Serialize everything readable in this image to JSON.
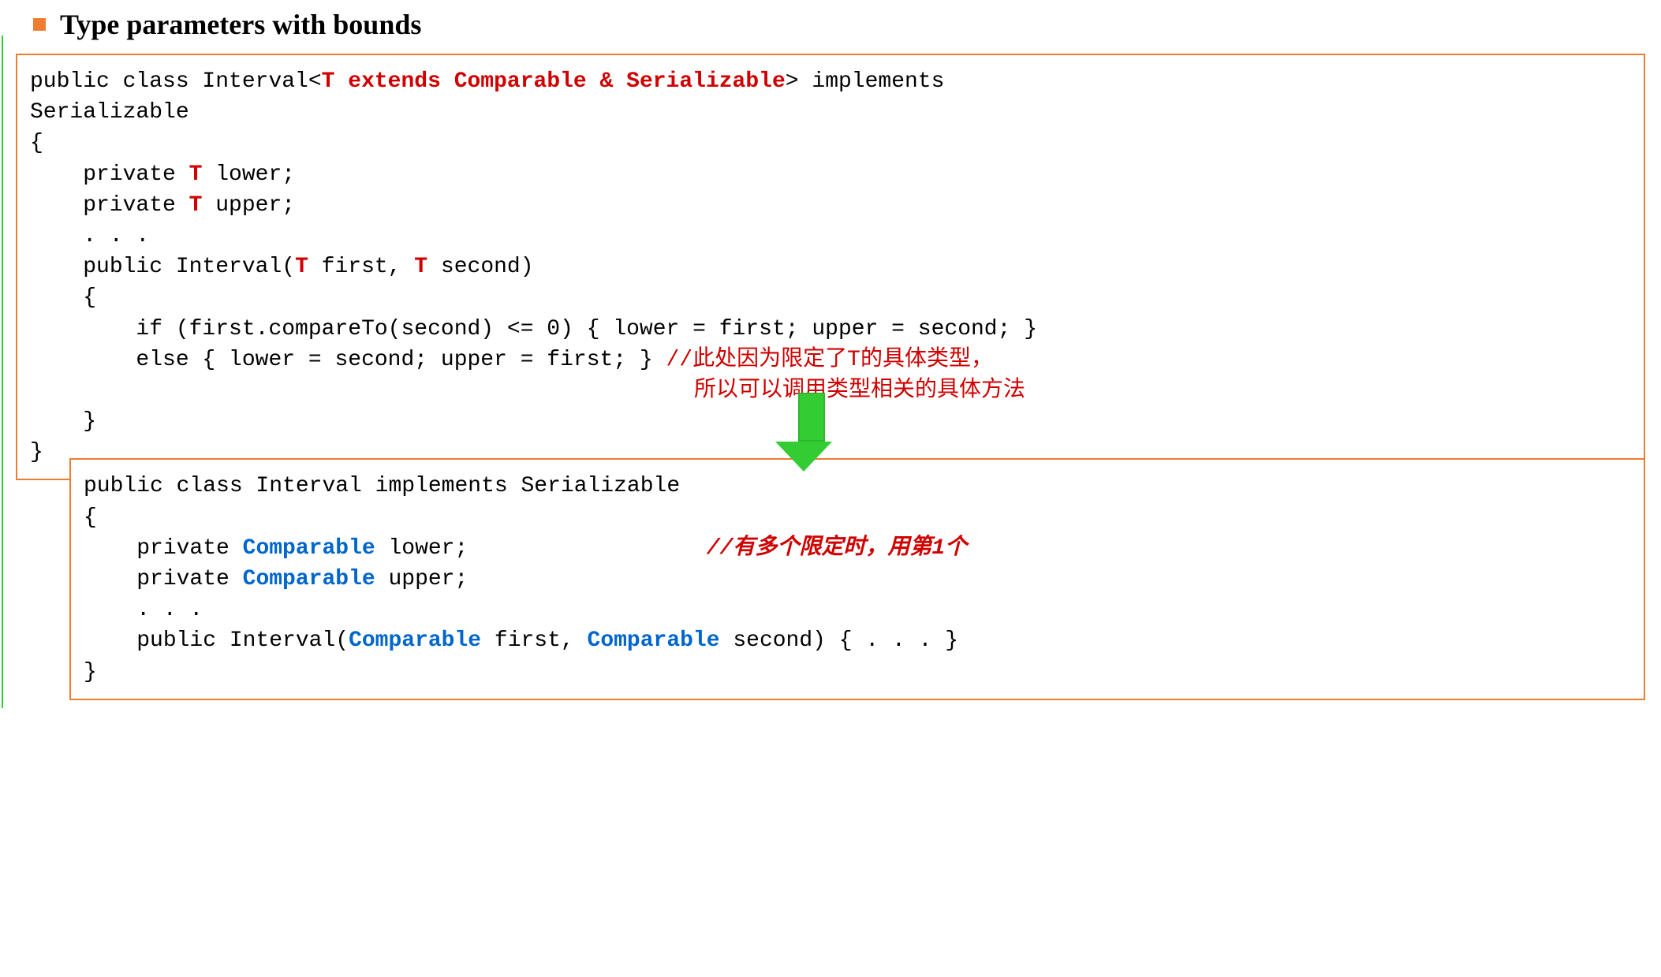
{
  "title": "Type parameters with bounds",
  "code1": {
    "l1a": "public class Interval<",
    "l1b": "T extends Comparable & Serializable",
    "l1c": "> implements",
    "l2": "Serializable",
    "l3": "{",
    "l4a": "    private ",
    "l4b": "T",
    "l4c": " lower;",
    "l5a": "    private ",
    "l5b": "T",
    "l5c": " upper;",
    "l6": "    . . .",
    "l7a": "    public Interval(",
    "l7b": "T",
    "l7c": " first, ",
    "l7d": "T",
    "l7e": " second)",
    "l8": "    {",
    "l9": "        if (first.compareTo(second) <= 0) { lower = first; upper = second; }",
    "l10a": "        else { lower = second; upper = first; } ",
    "l10b": "//此处因为限定了T的具体类型，",
    "l10c": "所以可以调用类型相关的具体方法",
    "l11": "    }",
    "l12": "}"
  },
  "code2": {
    "l1": "public class Interval implements Serializable",
    "l2": "{",
    "l3a": "    private ",
    "l3b": "Comparable",
    "l3c": " lower;",
    "l4a": "    private ",
    "l4b": "Comparable",
    "l4c": " upper;",
    "l5": "    . . .",
    "l6a": "    public Interval(",
    "l6b": "Comparable",
    "l6c": " first, ",
    "l6d": "Comparable",
    "l6e": " second) { . . . }",
    "l7": "}",
    "comment": "//有多个限定时，用第1个"
  }
}
